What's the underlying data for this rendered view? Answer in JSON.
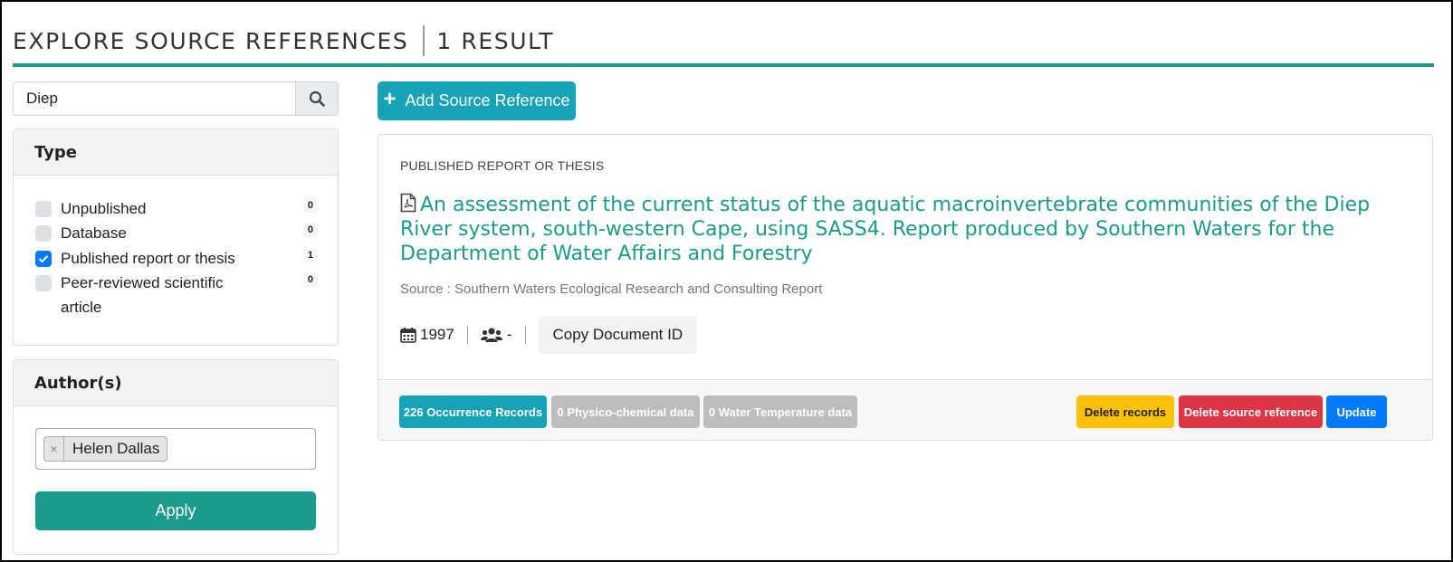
{
  "header": {
    "title": "EXPLORE SOURCE REFERENCES",
    "result_count": "1 RESULT"
  },
  "search": {
    "value": "Diep",
    "icon": "search-icon"
  },
  "type_filter": {
    "heading": "Type",
    "options": [
      {
        "label": "Unpublished",
        "count": "0",
        "checked": false
      },
      {
        "label": "Database",
        "count": "0",
        "checked": false
      },
      {
        "label": "Published report or thesis",
        "count": "1",
        "checked": true
      },
      {
        "label": "Peer-reviewed scientific article",
        "count": "0",
        "checked": false
      }
    ]
  },
  "author_filter": {
    "heading": "Author(s)",
    "selected": [
      {
        "remove": "×",
        "name": "Helen Dallas"
      }
    ],
    "apply_label": "Apply"
  },
  "add_button": {
    "icon": "plus-icon",
    "label": "Add Source Reference"
  },
  "result": {
    "type": "PUBLISHED REPORT OR THESIS",
    "title": "An assessment of the current status of the aquatic macroinvertebrate communities of the Diep River system, south-western Cape, using SASS4. Report produced by Southern Waters for the Department of Water Affairs and Forestry",
    "source": "Source : Southern Waters Ecological Research and Consulting Report",
    "year": "1997",
    "authors": "-",
    "copy_label": "Copy Document ID",
    "footer": {
      "occurrence": "226 Occurrence Records",
      "physico": "0 Physico-chemical data",
      "water_temp": "0 Water Temperature data",
      "delete_records": "Delete records",
      "delete_source": "Delete source reference",
      "update": "Update"
    }
  },
  "colors": {
    "accent": "#1a9b8b",
    "info": "#17a2b8",
    "primary": "#007bff",
    "warning": "#ffc107",
    "danger": "#dc3545"
  }
}
